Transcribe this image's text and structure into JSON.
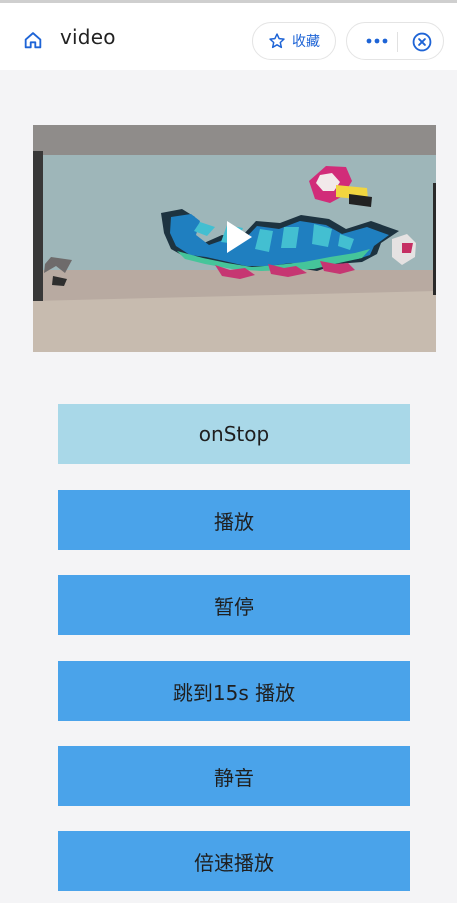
{
  "header": {
    "title": "video",
    "favorite_label": "收藏"
  },
  "video": {
    "state": "paused"
  },
  "buttons": [
    {
      "label": "onStop"
    },
    {
      "label": "播放"
    },
    {
      "label": "暂停"
    },
    {
      "label": "跳到15s 播放"
    },
    {
      "label": "静音"
    },
    {
      "label": "倍速播放"
    }
  ],
  "icons": {
    "home": "home-icon",
    "favorite": "star-icon",
    "more": "more-icon",
    "close": "close-icon",
    "play": "play-icon"
  },
  "colors": {
    "accent": "#1e64d6",
    "button_active": "#a9d8e8",
    "button": "#4aa3ea",
    "background": "#f4f4f6"
  }
}
